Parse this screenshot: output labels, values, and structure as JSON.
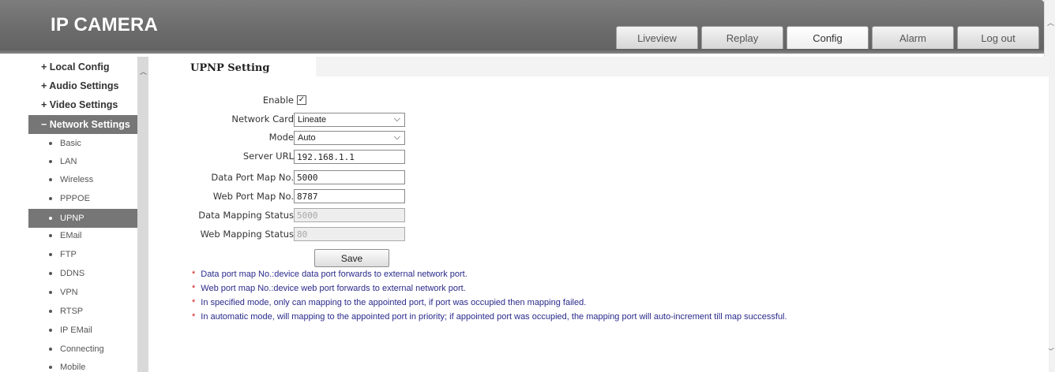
{
  "header": {
    "title": "IP CAMERA",
    "tabs": [
      "Liveview",
      "Replay",
      "Config",
      "Alarm",
      "Log out"
    ],
    "active_tab": "Config"
  },
  "sidebar": {
    "groups": [
      "+ Local Config",
      "+ Audio Settings",
      "+ Video Settings",
      "− Network Settings"
    ],
    "items": [
      "Basic",
      "LAN",
      "Wireless",
      "PPPOE",
      "UPNP",
      "EMail",
      "FTP",
      "DDNS",
      "VPN",
      "RTSP",
      "IP EMail",
      "Connecting",
      "Mobile"
    ],
    "active_item": "UPNP"
  },
  "content": {
    "tab_title": "UPNP Setting"
  },
  "form": {
    "enable_label": "Enable",
    "enable_checked": true,
    "check_mark": "✓",
    "network_card_label": "Network Card",
    "network_card_value": "Lineate",
    "mode_label": "Mode",
    "mode_value": "Auto",
    "server_url_label": "Server URL",
    "server_url_value": "192.168.1.1",
    "data_port_label": "Data Port Map No.",
    "data_port_value": "5000",
    "web_port_label": "Web Port Map No.",
    "web_port_value": "8787",
    "data_status_label": "Data Mapping Status",
    "data_status_value": "5000",
    "web_status_label": "Web Mapping Status",
    "web_status_value": "80",
    "save_label": "Save"
  },
  "notes": [
    "Data port map No.:device data port forwards to external network port.",
    "Web port map No.:device web port forwards to external network port.",
    "In specified mode, only can mapping to the appointed port, if port was occupied then mapping failed.",
    "In automatic mode, will mapping to the appointed port in priority; if appointed port was occupied, the mapping port will auto-increment till map successful."
  ],
  "note_marker": "*",
  "colors": {
    "header": "#6e6e6e",
    "active_nav": "#767676",
    "note_text": "#2a2a8c",
    "note_marker": "#d01818"
  },
  "icons": [
    "checkbox-check-icon",
    "chevron-down-icon",
    "scroll-up-icon",
    "scroll-down-icon",
    "bullet-icon"
  ]
}
